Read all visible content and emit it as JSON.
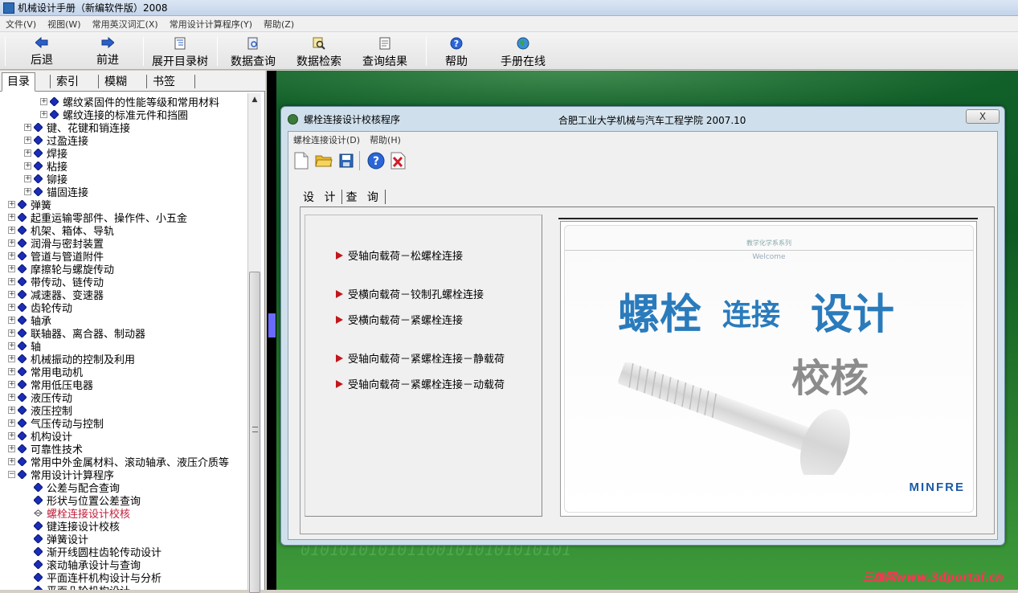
{
  "app": {
    "title": "机械设计手册（新编软件版）2008"
  },
  "menubar": [
    "文件(V)",
    "视图(W)",
    "常用英汉词汇(X)",
    "常用设计计算程序(Y)",
    "帮助(Z)"
  ],
  "toolbar": [
    {
      "label": "后退",
      "icon": "back-arrow-icon"
    },
    {
      "label": "前进",
      "icon": "forward-arrow-icon"
    },
    {
      "label": "展开目录树",
      "icon": "tree-icon"
    },
    {
      "label": "数据查询",
      "icon": "query-icon"
    },
    {
      "label": "数据检索",
      "icon": "search-icon"
    },
    {
      "label": "查询结果",
      "icon": "result-icon"
    },
    {
      "label": "帮助",
      "icon": "help-icon"
    },
    {
      "label": "手册在线",
      "icon": "globe-icon"
    }
  ],
  "left_tabs": [
    "目录",
    "索引",
    "模糊",
    "书签"
  ],
  "tree": [
    {
      "label": "螺纹紧固件的性能等级和常用材料",
      "level": 2
    },
    {
      "label": "螺纹连接的标准元件和挡圈",
      "level": 2
    },
    {
      "label": "键、花键和销连接",
      "level": 1
    },
    {
      "label": "过盈连接",
      "level": 1
    },
    {
      "label": "焊接",
      "level": 1
    },
    {
      "label": "粘接",
      "level": 1
    },
    {
      "label": "铆接",
      "level": 1
    },
    {
      "label": "锚固连接",
      "level": 1
    },
    {
      "label": "弹簧",
      "level": 0
    },
    {
      "label": "起重运输零部件、操作件、小五金",
      "level": 0
    },
    {
      "label": "机架、箱体、导轨",
      "level": 0
    },
    {
      "label": "润滑与密封装置",
      "level": 0
    },
    {
      "label": "管道与管道附件",
      "level": 0
    },
    {
      "label": "摩擦轮与螺旋传动",
      "level": 0
    },
    {
      "label": "带传动、链传动",
      "level": 0
    },
    {
      "label": "减速器、变速器",
      "level": 0
    },
    {
      "label": "齿轮传动",
      "level": 0
    },
    {
      "label": "轴承",
      "level": 0
    },
    {
      "label": "联轴器、离合器、制动器",
      "level": 0
    },
    {
      "label": "轴",
      "level": 0
    },
    {
      "label": "机械振动的控制及利用",
      "level": 0
    },
    {
      "label": "常用电动机",
      "level": 0
    },
    {
      "label": "常用低压电器",
      "level": 0
    },
    {
      "label": "液压传动",
      "level": 0
    },
    {
      "label": "液压控制",
      "level": 0
    },
    {
      "label": "气压传动与控制",
      "level": 0
    },
    {
      "label": "机构设计",
      "level": 0
    },
    {
      "label": "可靠性技术",
      "level": 0
    },
    {
      "label": "常用中外金属材料、滚动轴承、液压介质等",
      "level": 0
    },
    {
      "label": "常用设计计算程序",
      "level": 0,
      "expanded": true
    },
    {
      "label": "公差与配合查询",
      "level": 1,
      "leaf": true
    },
    {
      "label": "形状与位置公差查询",
      "level": 1,
      "leaf": true
    },
    {
      "label": "螺栓连接设计校核",
      "level": 1,
      "leaf": true,
      "selected": true
    },
    {
      "label": "键连接设计校核",
      "level": 1,
      "leaf": true
    },
    {
      "label": "弹簧设计",
      "level": 1,
      "leaf": true
    },
    {
      "label": "渐开线圆柱齿轮传动设计",
      "level": 1,
      "leaf": true
    },
    {
      "label": "滚动轴承设计与查询",
      "level": 1,
      "leaf": true
    },
    {
      "label": "平面连杆机构设计与分析",
      "level": 1,
      "leaf": true
    },
    {
      "label": "平面凸轮机构设计",
      "level": 1,
      "leaf": true
    }
  ],
  "dialog": {
    "title": "螺栓连接设计校核程序",
    "subtitle": "合肥工业大学机械与汽车工程学院 2007.10",
    "close_label": "X",
    "menu": [
      "螺栓连接设计(D)",
      "帮助(H)"
    ],
    "toolbar_icons": [
      "new-file-icon",
      "open-folder-icon",
      "save-icon",
      "help-icon",
      "exit-icon"
    ],
    "tabs": [
      "设 计",
      "查 询"
    ],
    "options": [
      "受轴向载荷－松螺栓连接",
      "受横向载荷－铰制孔螺栓连接",
      "受横向载荷－紧螺栓连接",
      "受轴向载荷－紧螺栓连接－静载荷",
      "受轴向载荷－紧螺栓连接－动载荷"
    ],
    "splash": {
      "series": "教学化学系系列",
      "welcome": "Welcome",
      "title_part1": "螺栓",
      "title_part2": "连接",
      "title_part3": "设计",
      "title_part4": "校核",
      "logo": "MINFRE"
    }
  },
  "watermark": "三维网www.3dportal.cn",
  "background_binary": "0101010101011001010101010101"
}
